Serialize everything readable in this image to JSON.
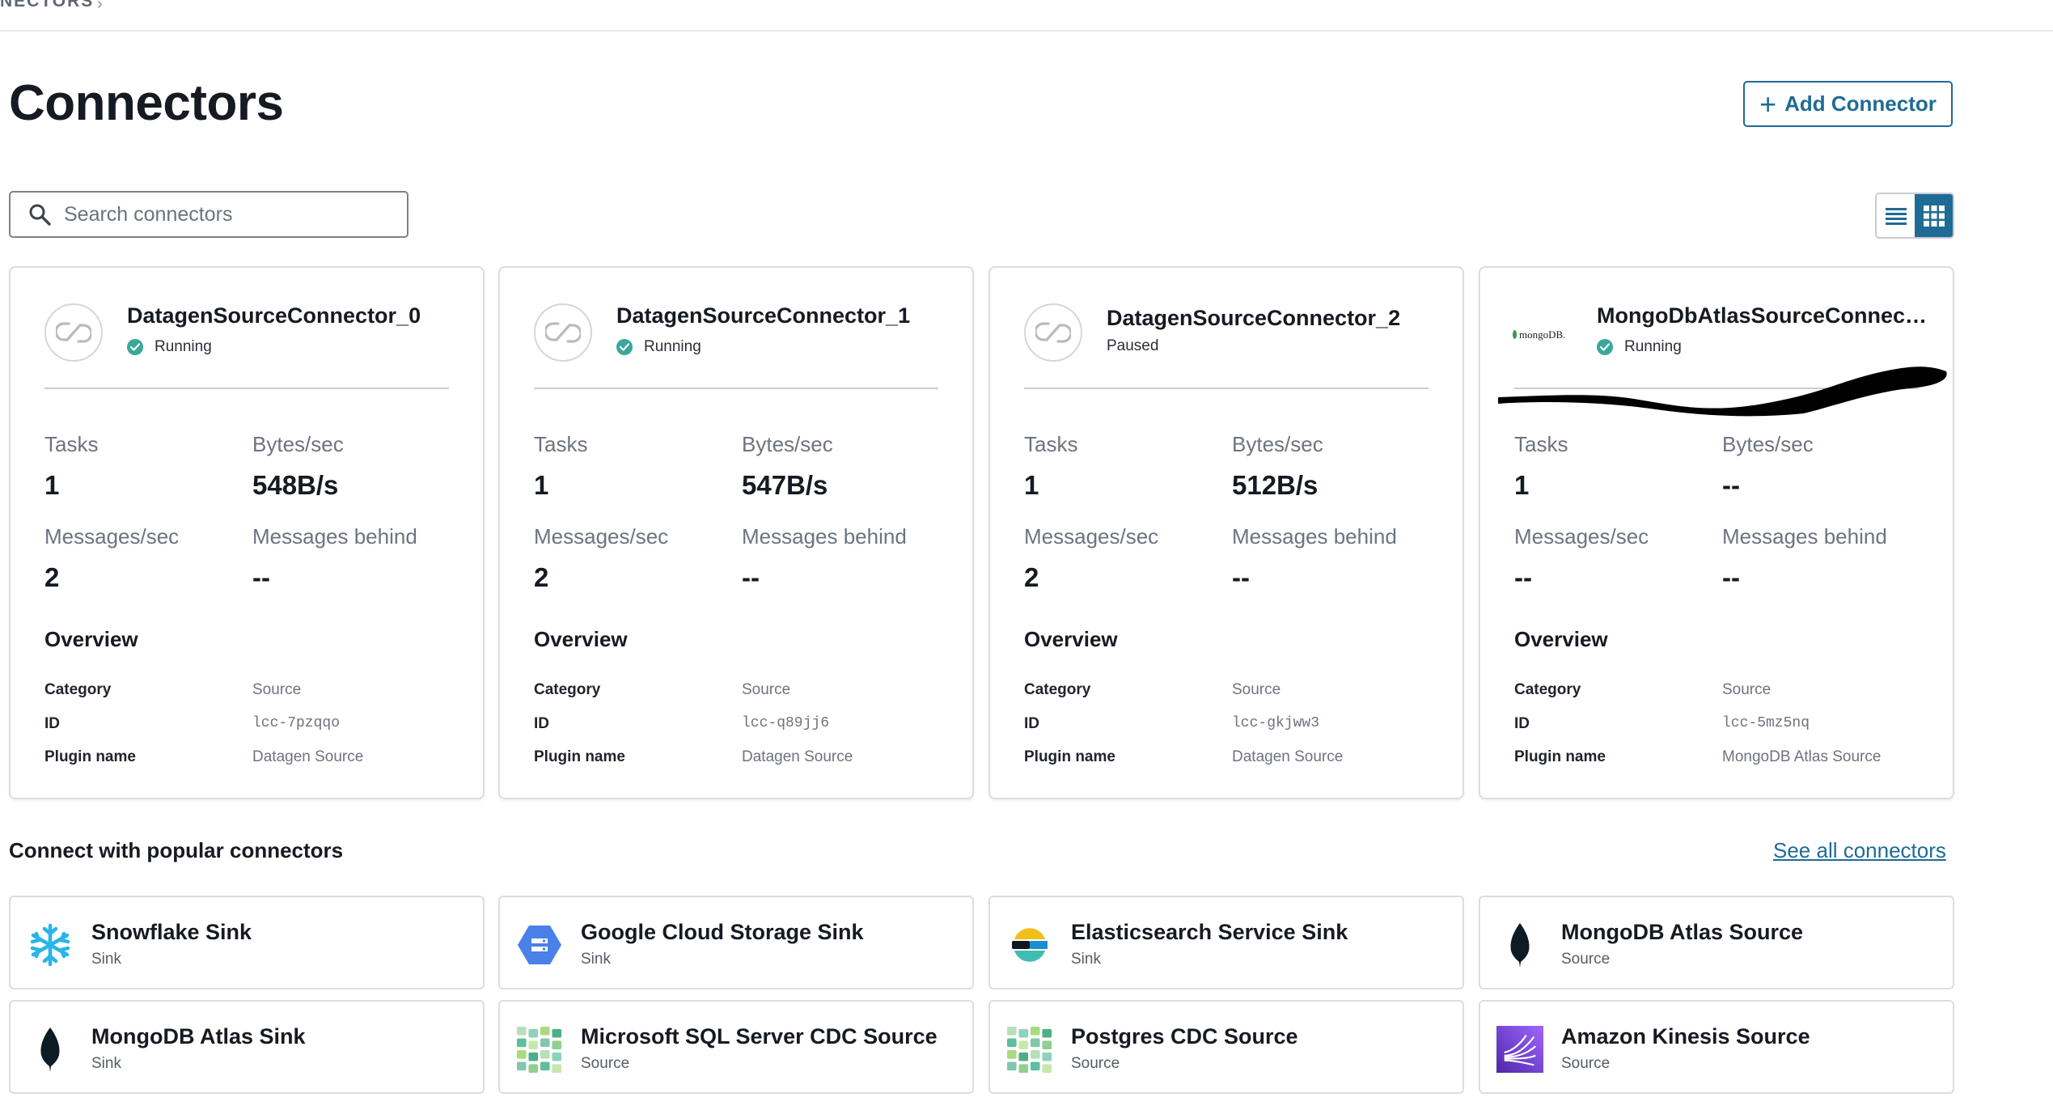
{
  "breadcrumb": {
    "text": "NECTORS",
    "chevron": "chevron-right-icon"
  },
  "page": {
    "title": "Connectors",
    "add_button": "Add Connector"
  },
  "search": {
    "placeholder": "Search connectors",
    "value": ""
  },
  "view_toggle": {
    "options": [
      "list-view-icon",
      "grid-view-icon"
    ],
    "active": "grid-view-icon"
  },
  "labels": {
    "tasks": "Tasks",
    "bytes": "Bytes/sec",
    "msgs": "Messages/sec",
    "behind": "Messages behind",
    "overview": "Overview",
    "category": "Category",
    "id": "ID",
    "plugin": "Plugin name"
  },
  "connectors": [
    {
      "name": "DatagenSourceConnector_0",
      "status": "Running",
      "status_color": "#3aa79a",
      "logo": "link-icon",
      "tasks": "1",
      "bytes": "548B/s",
      "msgs": "2",
      "behind": "--",
      "category": "Source",
      "id": "lcc-7pzqqo",
      "plugin": "Datagen Source"
    },
    {
      "name": "DatagenSourceConnector_1",
      "status": "Running",
      "status_color": "#3aa79a",
      "logo": "link-icon",
      "tasks": "1",
      "bytes": "547B/s",
      "msgs": "2",
      "behind": "--",
      "category": "Source",
      "id": "lcc-q89jj6",
      "plugin": "Datagen Source"
    },
    {
      "name": "DatagenSourceConnector_2",
      "status": "Paused",
      "status_color": "",
      "logo": "link-icon",
      "tasks": "1",
      "bytes": "512B/s",
      "msgs": "2",
      "behind": "--",
      "category": "Source",
      "id": "lcc-gkjww3",
      "plugin": "Datagen Source"
    },
    {
      "name": "MongoDbAtlasSourceConnect...",
      "status": "Running",
      "status_color": "#3aa79a",
      "logo": "mongodb-logo",
      "logo_text": "mongoDB.",
      "tasks": "1",
      "bytes": "--",
      "msgs": "--",
      "behind": "--",
      "category": "Source",
      "id": "lcc-5mz5nq",
      "plugin": "MongoDB Atlas Source"
    }
  ],
  "popular": {
    "title": "Connect with popular connectors",
    "see_all": "See all connectors",
    "items": [
      {
        "name": "Snowflake Sink",
        "type": "Sink",
        "icon": "snowflake-icon"
      },
      {
        "name": "Google Cloud Storage Sink",
        "type": "Sink",
        "icon": "google-cloud-storage-icon"
      },
      {
        "name": "Elasticsearch Service Sink",
        "type": "Sink",
        "icon": "elasticsearch-icon"
      },
      {
        "name": "MongoDB Atlas Source",
        "type": "Source",
        "icon": "mongodb-leaf-icon"
      },
      {
        "name": "MongoDB Atlas Sink",
        "type": "Sink",
        "icon": "mongodb-leaf-icon"
      },
      {
        "name": "Microsoft SQL Server CDC Source",
        "type": "Source",
        "icon": "debezium-grid-icon"
      },
      {
        "name": "Postgres CDC Source",
        "type": "Source",
        "icon": "debezium-grid-icon"
      },
      {
        "name": "Amazon Kinesis Source",
        "type": "Source",
        "icon": "amazon-kinesis-icon"
      }
    ]
  },
  "colors": {
    "accent": "#1f6b95",
    "running": "#3aa79a",
    "border": "#dadde2"
  }
}
